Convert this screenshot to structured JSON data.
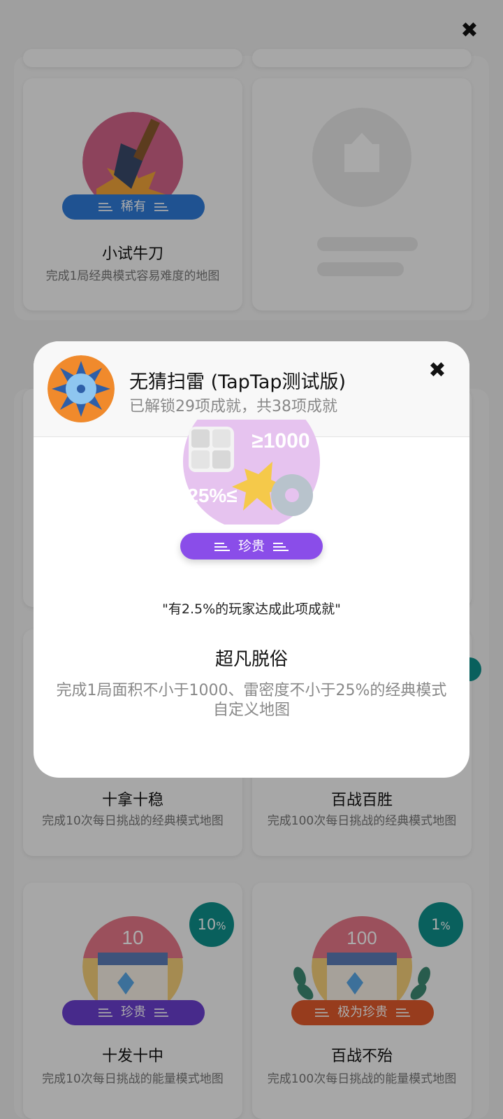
{
  "top_close_glyph": "✖",
  "cards": [
    {
      "title": "小试牛刀",
      "desc": "完成1局经典模式容易难度的地图",
      "rarity": "稀有",
      "rarity_color": "#2f7bd8"
    },
    {
      "title": "十拿十稳",
      "desc": "完成10次每日挑战的经典模式地图",
      "rarity_color": "#6b3fd0"
    },
    {
      "title": "百战百胜",
      "desc": "完成100次每日挑战的经典模式地图",
      "rarity_color": "#e15a2c"
    },
    {
      "title": "十发十中",
      "desc": "完成10次每日挑战的能量模式地图",
      "rarity": "珍贵",
      "rarity_color": "#6b3fd0",
      "percent": "10",
      "medal_number": "10"
    },
    {
      "title": "百战不殆",
      "desc": "完成100次每日挑战的能量模式地图",
      "rarity": "极为珍贵",
      "rarity_color": "#e15a2c",
      "percent": "1",
      "medal_number": "100"
    }
  ],
  "percent_suffix": "%",
  "modal": {
    "app_title": "无猜扫雷 (TapTap测试版)",
    "unlock_summary": "已解锁29项成就，共38项成就",
    "close_glyph": "✖",
    "medal_text_top": "≥1000",
    "medal_text_bottom": "25%≤",
    "rarity": "珍贵",
    "rarity_color": "#8a4de9",
    "quote": "\"有2.5%的玩家达成此项成就\"",
    "achievement_title": "超凡脱俗",
    "achievement_desc": "完成1局面积不小于1000、雷密度不小于25%的经典模式自定义地图"
  }
}
